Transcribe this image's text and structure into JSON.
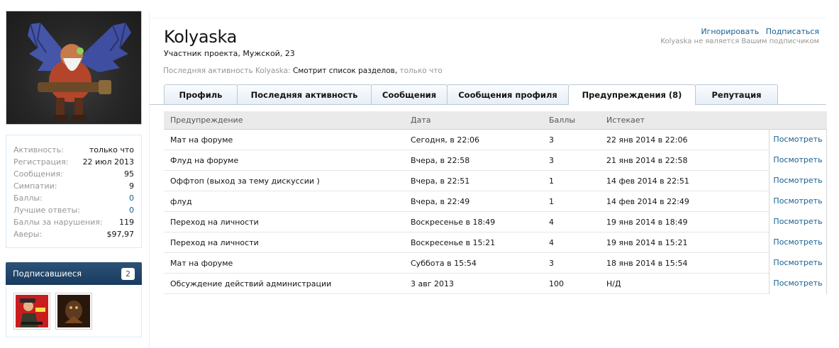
{
  "stats": [
    {
      "label": "Активность:",
      "value": "только что",
      "link": false
    },
    {
      "label": "Регистрация:",
      "value": "22 июл 2013",
      "link": false
    },
    {
      "label": "Сообщения:",
      "value": "95",
      "link": false
    },
    {
      "label": "Симпатии:",
      "value": "9",
      "link": false
    },
    {
      "label": "Баллы:",
      "value": "0",
      "link": true
    },
    {
      "label": "Лучшие ответы:",
      "value": "0",
      "link": true
    },
    {
      "label": "Баллы за нарушения:",
      "value": "119",
      "link": false
    },
    {
      "label": "Аверы:",
      "value": "$97,97",
      "link": false
    }
  ],
  "followers": {
    "title": "Подписавшиеся",
    "count": "2"
  },
  "profile": {
    "username": "Kolyaska",
    "blurb": "Участник проекта, Мужской, 23",
    "ignore": "Игнорировать",
    "subscribe": "Подписаться",
    "not_following": "Kolyaska не является Вашим подписчиком",
    "activity_prefix": "Последняя активность Kolyaska:",
    "activity_text": "Смотрит список разделов,",
    "activity_time": "только что"
  },
  "tabs": [
    {
      "label": "Профиль",
      "active": false
    },
    {
      "label": "Последняя активность",
      "active": false
    },
    {
      "label": "Сообщения",
      "active": false
    },
    {
      "label": "Сообщения профиля",
      "active": false
    },
    {
      "label": "Предупреждения (8)",
      "active": true
    },
    {
      "label": "Репутация",
      "active": false
    }
  ],
  "table": {
    "headers": [
      "Предупреждение",
      "Дата",
      "Баллы",
      "Истекает"
    ],
    "view_label": "Посмотреть",
    "rows": [
      [
        "Мат на форуме",
        "Сегодня, в 22:06",
        "3",
        "22 янв 2014 в 22:06"
      ],
      [
        "Флуд на форуме",
        "Вчера, в 22:58",
        "3",
        "21 янв 2014 в 22:58"
      ],
      [
        "Оффтоп (выход за тему дискуссии )",
        "Вчера, в 22:51",
        "1",
        "14 фев 2014 в 22:51"
      ],
      [
        "флуд",
        "Вчера, в 22:49",
        "1",
        "14 фев 2014 в 22:49"
      ],
      [
        "Переход на личности",
        "Воскресенье в 18:49",
        "4",
        "19 янв 2014 в 18:49"
      ],
      [
        "Переход на личности",
        "Воскресенье в 15:21",
        "4",
        "19 янв 2014 в 15:21"
      ],
      [
        "Мат на форуме",
        "Суббота в 15:54",
        "3",
        "18 янв 2014 в 15:54"
      ],
      [
        "Обсуждение действий администрации",
        "3 авг 2013",
        "100",
        "Н/Д"
      ]
    ]
  }
}
